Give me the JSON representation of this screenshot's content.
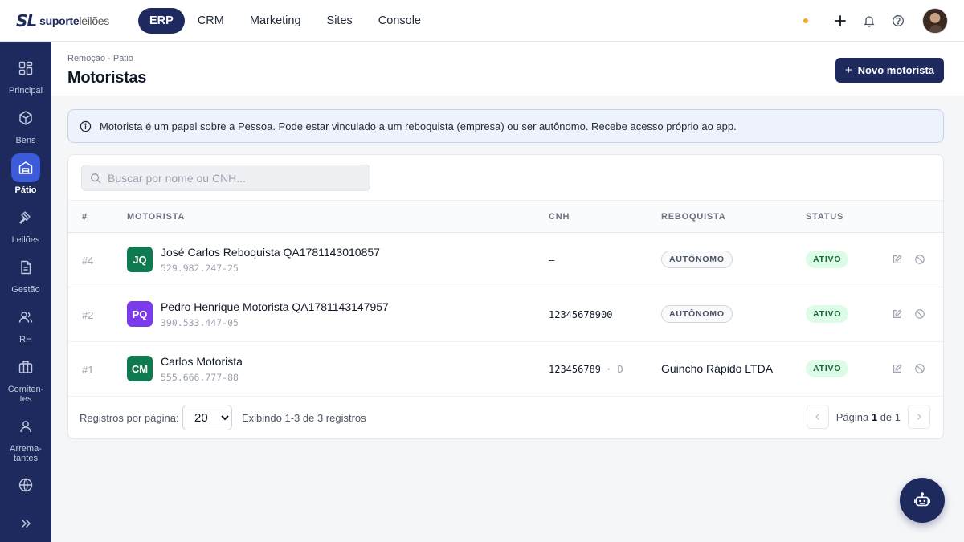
{
  "brand": {
    "mark": "SL",
    "name_bold": "suporte",
    "name_light": "leilões"
  },
  "topnav": {
    "items": [
      "ERP",
      "CRM",
      "Marketing",
      "Sites",
      "Console"
    ],
    "active": "ERP"
  },
  "sidebar": {
    "items": [
      {
        "label": "Principal",
        "icon": "grid-icon"
      },
      {
        "label": "Bens",
        "icon": "box-icon"
      },
      {
        "label": "Pátio",
        "icon": "warehouse-icon",
        "active": true
      },
      {
        "label": "Leilões",
        "icon": "gavel-icon"
      },
      {
        "label": "Gestão",
        "icon": "document-icon"
      },
      {
        "label": "RH",
        "icon": "users-icon"
      },
      {
        "label": "Comiten-tes",
        "icon": "briefcase-icon"
      },
      {
        "label": "Arrema-tantes",
        "icon": "user-icon"
      },
      {
        "label": "",
        "icon": "globe-icon"
      }
    ],
    "expand_icon": "chevrons-right-icon"
  },
  "page": {
    "breadcrumb": "Remoção · Pátio",
    "title": "Motoristas",
    "new_button": "Novo motorista"
  },
  "info_banner": "Motorista é um papel sobre a Pessoa. Pode estar vinculado a um reboquista (empresa) ou ser autônomo. Recebe acesso próprio ao app.",
  "search": {
    "placeholder": "Buscar por nome ou CNH...",
    "value": ""
  },
  "table": {
    "headers": {
      "num": "#",
      "driver": "MOTORISTA",
      "cnh": "CNH",
      "tow": "REBOQUISTA",
      "status": "STATUS"
    },
    "rows": [
      {
        "num": "#4",
        "initials": "JQ",
        "avatar_color": "#0f7a4f",
        "name": "José Carlos Reboquista QA1781143010857",
        "doc": "529.982.247-25",
        "cnh": "—",
        "cnh_cat": "",
        "tow": "AUTÔNOMO",
        "tow_is_badge": true,
        "status": "ATIVO"
      },
      {
        "num": "#2",
        "initials": "PQ",
        "avatar_color": "#7c3aed",
        "name": "Pedro Henrique Motorista QA1781143147957",
        "doc": "390.533.447-05",
        "cnh": "12345678900",
        "cnh_cat": "",
        "tow": "AUTÔNOMO",
        "tow_is_badge": true,
        "status": "ATIVO"
      },
      {
        "num": "#1",
        "initials": "CM",
        "avatar_color": "#0f7a4f",
        "name": "Carlos Motorista",
        "doc": "555.666.777-88",
        "cnh": "123456789",
        "cnh_cat": "· D",
        "tow": "Guincho Rápido LTDA",
        "tow_is_badge": false,
        "status": "ATIVO"
      }
    ]
  },
  "footer": {
    "per_page_label": "Registros por página:",
    "per_page_value": "20",
    "showing": "Exibindo 1-3 de 3 registros",
    "page_word": "Página",
    "page_current": "1",
    "page_of": "de 1"
  },
  "colors": {
    "navy": "#1e2a5e",
    "active_blue": "#3b5bdb",
    "status_green": "#166534",
    "notification_dot": "#f5a524"
  }
}
